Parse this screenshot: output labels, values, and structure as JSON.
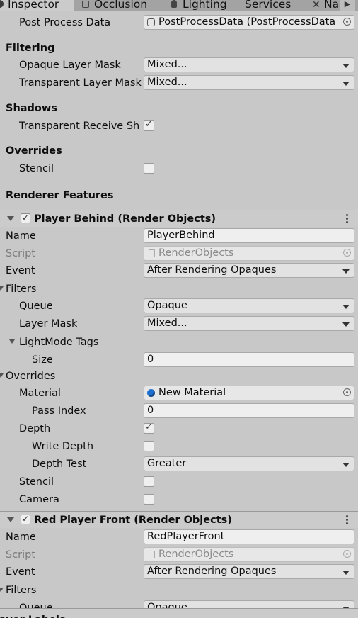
{
  "tabs": {
    "inspector": "Inspector",
    "occlusion": "Occlusion",
    "lighting": "Lighting",
    "services": "Services",
    "navigation": "Na"
  },
  "renderer": {
    "post_process_label": "Post Process Data",
    "post_process_value": "PostProcessData (PostProcessData",
    "filtering_header": "Filtering",
    "opaque_mask_label": "Opaque Layer Mask",
    "opaque_mask_value": "Mixed...",
    "transparent_mask_label": "Transparent Layer Mask",
    "transparent_mask_value": "Mixed...",
    "shadows_header": "Shadows",
    "transparent_receive_label": "Transparent Receive Sh",
    "overrides_header": "Overrides",
    "stencil_label": "Stencil",
    "features_header": "Renderer Features"
  },
  "feature1": {
    "title": "Player Behind (Render Objects)",
    "name_label": "Name",
    "name_value": "PlayerBehind",
    "script_label": "Script",
    "script_value": "RenderObjects",
    "event_label": "Event",
    "event_value": "After Rendering Opaques",
    "filters_label": "Filters",
    "queue_label": "Queue",
    "queue_value": "Opaque",
    "layer_mask_label": "Layer Mask",
    "layer_mask_value": "Mixed...",
    "lightmode_label": "LightMode Tags",
    "size_label": "Size",
    "size_value": "0",
    "overrides_label": "Overrides",
    "material_label": "Material",
    "material_value": "New Material",
    "pass_index_label": "Pass Index",
    "pass_index_value": "0",
    "depth_label": "Depth",
    "write_depth_label": "Write Depth",
    "depth_test_label": "Depth Test",
    "depth_test_value": "Greater",
    "stencil_label": "Stencil",
    "camera_label": "Camera"
  },
  "feature2": {
    "title": "Red Player Front (Render Objects)",
    "name_label": "Name",
    "name_value": "RedPlayerFront",
    "script_label": "Script",
    "script_value": "RenderObjects",
    "event_label": "Event",
    "event_value": "After Rendering Opaques",
    "filters_label": "Filters",
    "queue_label": "Queue",
    "queue_value": "Opaque"
  },
  "bottom_partial_header": "ayer Labels",
  "colors": {
    "panel": "#c8c8c8",
    "tab_strip": "#a3a3a3",
    "field": "#efefef",
    "material_icon": "#1f6fd1"
  }
}
